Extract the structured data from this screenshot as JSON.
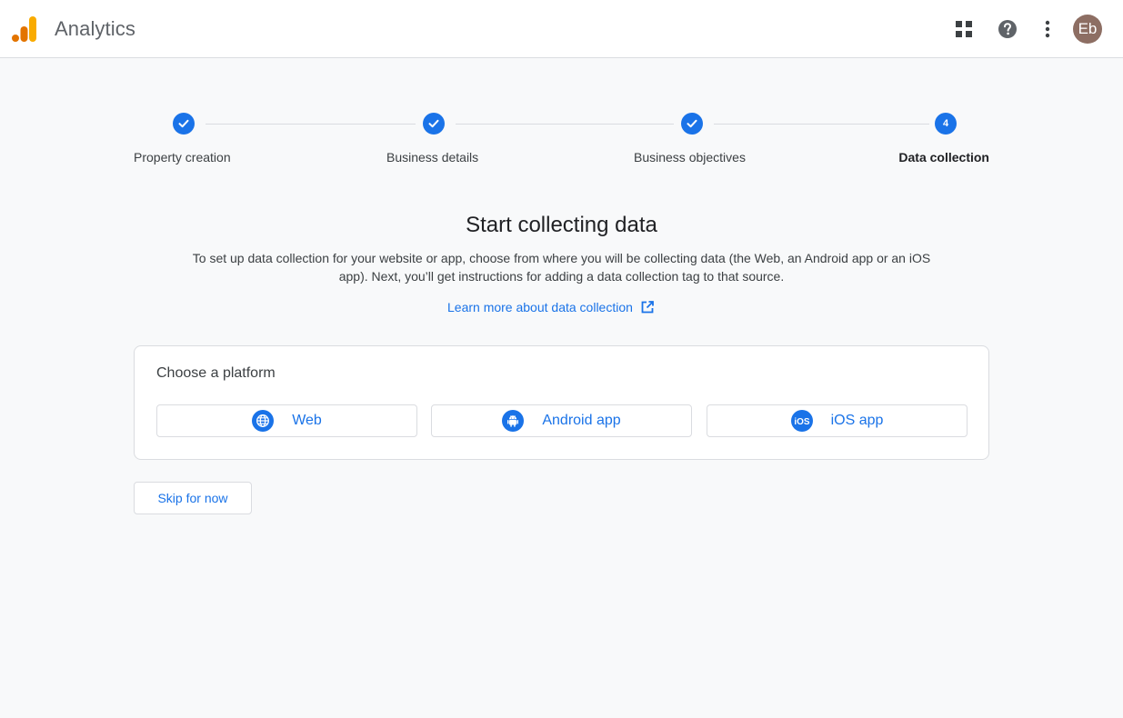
{
  "header": {
    "app_title": "Analytics",
    "icons": [
      "apps-grid-icon",
      "help-icon",
      "more-vert-icon"
    ],
    "avatar_initials": "Eb"
  },
  "stepper": {
    "steps": [
      {
        "label": "Property creation",
        "state": "completed"
      },
      {
        "label": "Business details",
        "state": "completed"
      },
      {
        "label": "Business objectives",
        "state": "completed"
      },
      {
        "label": "Data collection",
        "state": "active",
        "number": "4"
      }
    ]
  },
  "main": {
    "headline": "Start collecting data",
    "description": "To set up data collection for your website or app, choose from where you will be collecting data (the Web, an Android app or an iOS app). Next, you’ll get instructions for adding a data collection tag to that source.",
    "learn_more_label": "Learn more about data collection"
  },
  "platform_card": {
    "title": "Choose a platform",
    "options": [
      {
        "label": "Web",
        "icon": "globe-icon"
      },
      {
        "label": "Android app",
        "icon": "android-icon"
      },
      {
        "label": "iOS app",
        "icon": "ios-icon",
        "icon_text": "iOS"
      }
    ]
  },
  "skip_label": "Skip for now",
  "colors": {
    "accent": "#1a73e8",
    "logo_dark": "#e37400",
    "logo_light": "#f9ab00",
    "avatar": "#8d6e63"
  }
}
